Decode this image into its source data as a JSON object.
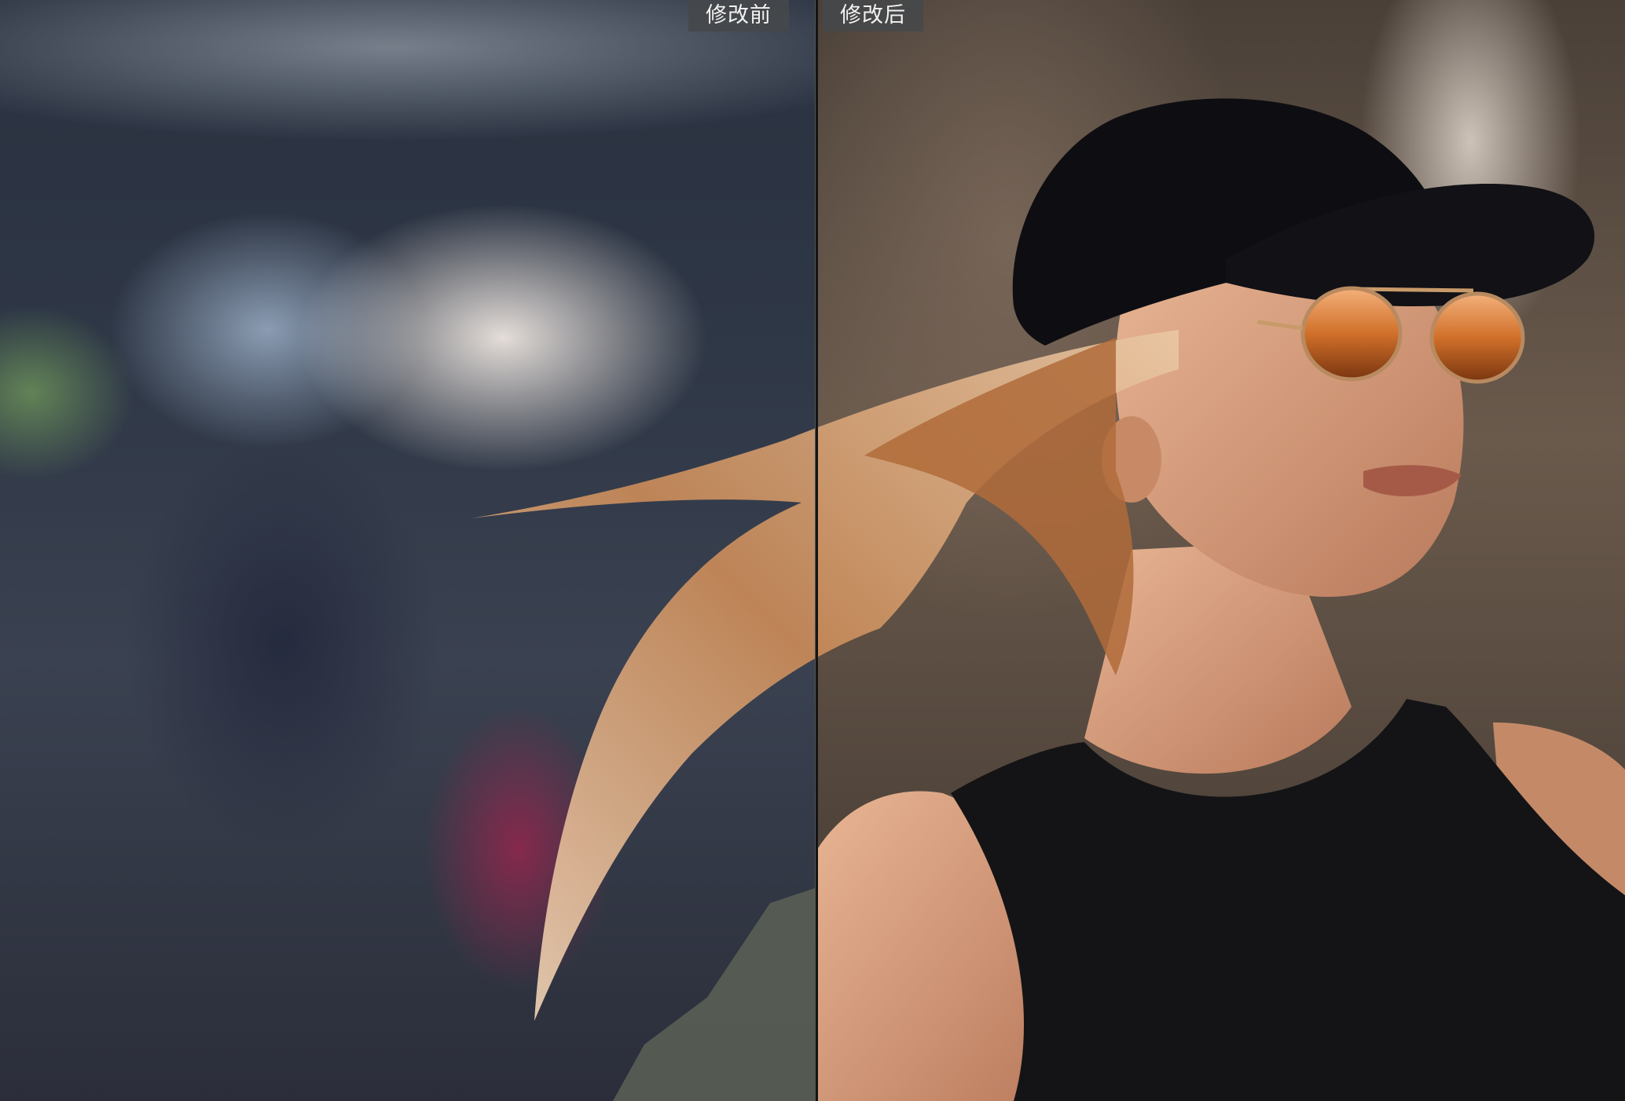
{
  "comparison": {
    "before_label": "修改前",
    "after_label": "修改后"
  },
  "colors": {
    "label_background": "#46484a",
    "label_text": "#f2f2f2",
    "divider": "#141414"
  }
}
